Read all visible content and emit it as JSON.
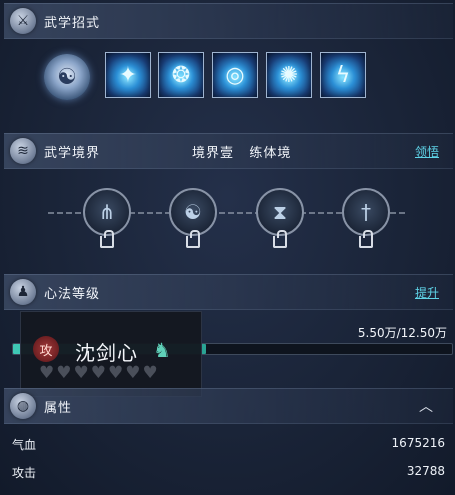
{
  "martial_moves": {
    "title": "武学招式",
    "section_icon": "sword-icon",
    "manual_icon": "scroll-icon",
    "skills": [
      {
        "icon": "blade-slash-icon"
      },
      {
        "icon": "whirlwind-icon"
      },
      {
        "icon": "ripple-icon"
      },
      {
        "icon": "spiral-strike-icon"
      },
      {
        "icon": "lightning-figure-icon"
      },
      {
        "icon": "leaping-strike-icon"
      }
    ]
  },
  "martial_realm": {
    "title": "武学境界",
    "section_icon": "cloud-swirl-icon",
    "realm_level": "境界壹",
    "realm_stage": "练体境",
    "link": "领悟",
    "nodes": [
      {
        "icon": "blade-fan-icon",
        "locked": true
      },
      {
        "icon": "yin-yang-icon",
        "locked": true
      },
      {
        "icon": "hourglass-blade-icon",
        "locked": true
      },
      {
        "icon": "sword-emblem-icon",
        "locked": true
      }
    ]
  },
  "heart_method": {
    "title": "心法等级",
    "section_icon": "meditation-icon",
    "link": "提升",
    "progress_text": "5.50万/12.50万",
    "progress_value": 0.44,
    "tooltip": {
      "badge": "攻",
      "name": "沈剑心",
      "figure_icon": "swordsman-icon",
      "hearts_total": 7,
      "hearts_filled": 0
    }
  },
  "attributes": {
    "title": "属性",
    "section_icon": "droplet-icon",
    "collapse_icon": "chevron-up-icon",
    "rows": [
      {
        "label": "气血",
        "value": "1675216"
      },
      {
        "label": "攻击",
        "value": "32788"
      }
    ]
  },
  "colors": {
    "accent_link": "#5fd4e8",
    "progress_fill": "#3fc9b6",
    "badge_red": "#a23a3a"
  }
}
